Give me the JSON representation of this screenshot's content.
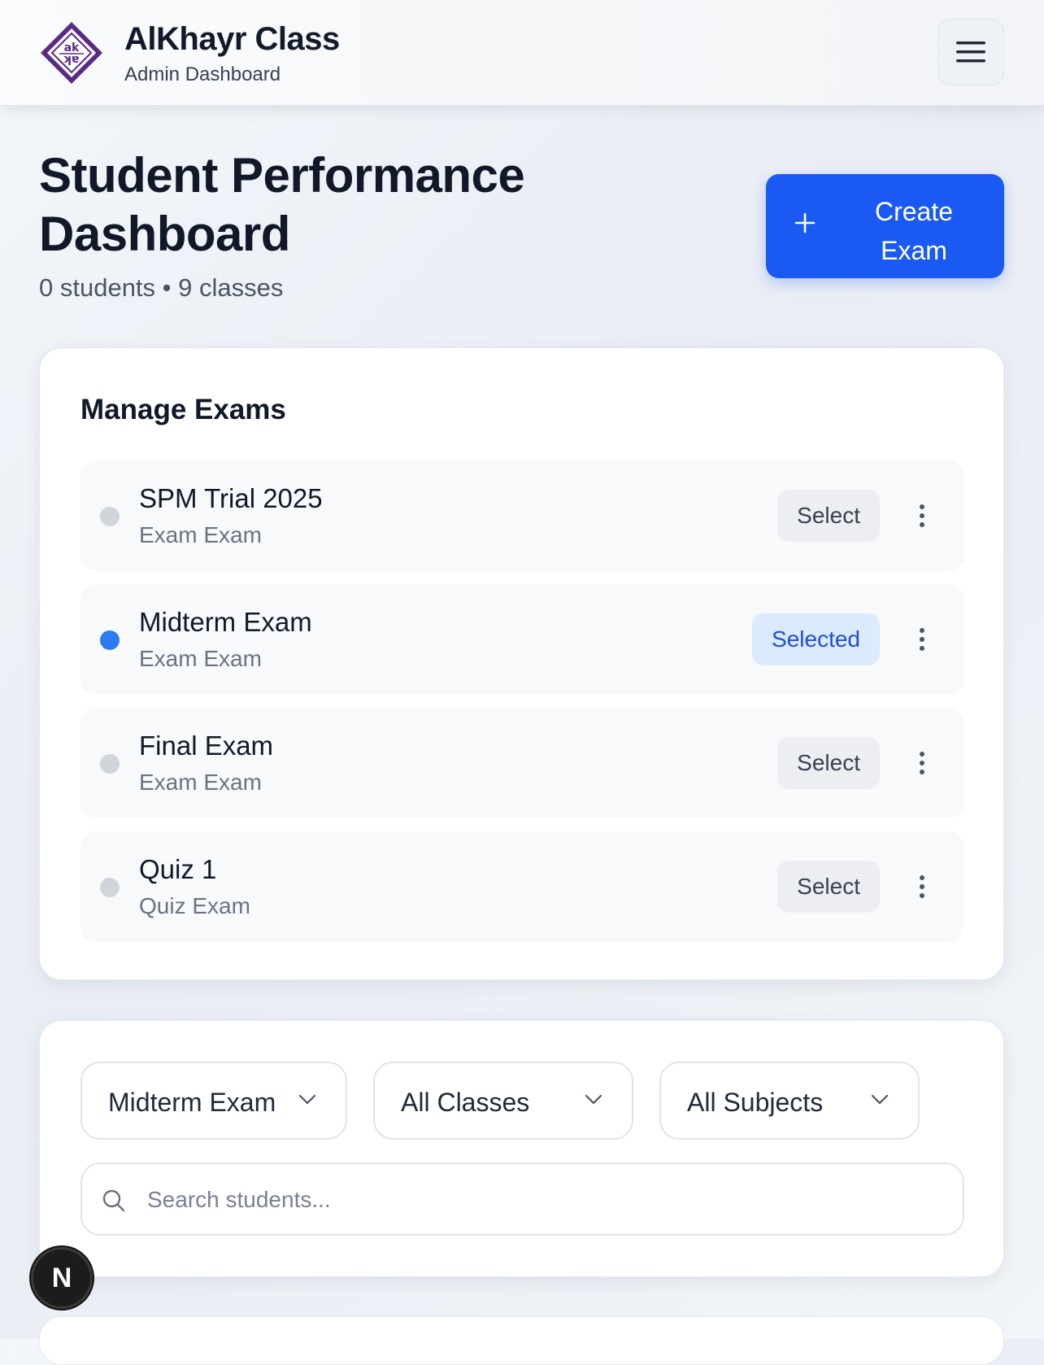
{
  "header": {
    "app_title": "AlKhayr Class",
    "app_subtitle": "Admin Dashboard",
    "logo_icon": "alkhayr-logo-icon",
    "menu_icon": "hamburger-menu-icon"
  },
  "page": {
    "title": "Student Performance Dashboard",
    "meta": "0 students • 9 classes",
    "create_button": "Create Exam"
  },
  "manage_exams": {
    "title": "Manage Exams",
    "exams": [
      {
        "name": "SPM Trial 2025",
        "type": "Exam Exam",
        "action": "Select",
        "selected": false
      },
      {
        "name": "Midterm Exam",
        "type": "Exam Exam",
        "action": "Selected",
        "selected": true
      },
      {
        "name": "Final Exam",
        "type": "Exam Exam",
        "action": "Select",
        "selected": false
      },
      {
        "name": "Quiz 1",
        "type": "Quiz Exam",
        "action": "Select",
        "selected": false
      }
    ]
  },
  "filters": {
    "exam": "Midterm Exam",
    "class": "All Classes",
    "subject": "All Subjects",
    "search_placeholder": "Search students..."
  },
  "dev_badge": "N",
  "colors": {
    "accent": "#1a5af2",
    "selected_dot": "#2b7bf1",
    "selected_bg": "#dbeafe",
    "logo_purple": "#5b2a86"
  }
}
